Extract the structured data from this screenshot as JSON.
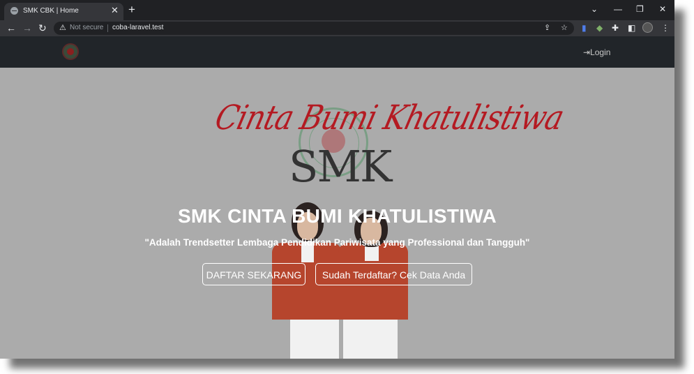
{
  "browser": {
    "tab_title": "SMK CBK | Home",
    "tab_close": "✕",
    "new_tab": "+",
    "security_label": "Not secure",
    "url": "coba-laravel.test",
    "window_controls": {
      "chevron": "⌄",
      "minimize": "—",
      "restore": "❐",
      "close": "✕"
    },
    "nav": {
      "back": "←",
      "forward": "→",
      "reload": "↻"
    }
  },
  "navbar": {
    "login_label": "Login",
    "login_icon": "⇥"
  },
  "hero": {
    "script_title": "Cinta Bumi Khatulistiwa",
    "logo_text": "SMK",
    "title": "SMK CINTA BUMI KHATULISTIWA",
    "tagline": "\"Adalah Trendsetter Lembaga Pendidikan Pariwisata yang Professional dan Tangguh\"",
    "register_button": "DAFTAR SEKARANG",
    "check_button": "Sudah Terdaftar? Cek Data Anda"
  },
  "colors": {
    "accent_red": "#b41a22",
    "navbar_bg": "#212529",
    "hero_bg": "#ababab",
    "jacket": "#b6452d"
  }
}
